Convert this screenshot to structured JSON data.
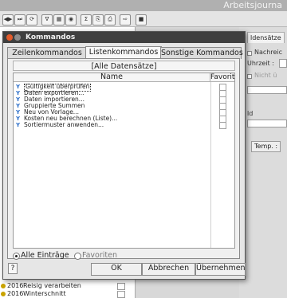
{
  "app": {
    "title": "Arbeitsjourna",
    "toolbar_icons": [
      "first-icon",
      "last-icon",
      "refresh-icon",
      "filter-icon",
      "grid-icon",
      "chart-icon",
      "sum-icon",
      "copy-icon",
      "print-icon",
      "export-icon",
      "stop-icon"
    ],
    "toolbar_glyphs": [
      "◀▶",
      "⏭",
      "⟳",
      "∇",
      "▦",
      "◉",
      "Σ",
      "⎘",
      "⎙",
      "⇨",
      "■"
    ],
    "list_rows": [
      {
        "year": "2016",
        "text": "Reisig verarbeiten"
      },
      {
        "year": "2016",
        "text": "Winterschnitt"
      }
    ],
    "right_panel": {
      "tab": "ldensätze",
      "nachricht": "Nachreic",
      "uhrzeit": "Uhrzeit :",
      "nicht": "Nicht ü",
      "field_suffix": "ld",
      "temp": "Temp. :"
    }
  },
  "dialog": {
    "title": "Kommandos",
    "tabs": [
      {
        "label": "Zeilenkommandos",
        "active": false
      },
      {
        "label": "Listenkommandos",
        "active": true
      },
      {
        "label": "Sonstige Kommandos",
        "active": false
      }
    ],
    "header": "[Alle Datensätze]",
    "columns": {
      "name": "Name",
      "favorit": "Favorit"
    },
    "commands": [
      {
        "label": "Gültigkeit überprüfen",
        "favorit": false,
        "selected": true
      },
      {
        "label": "Daten exportieren...",
        "favorit": false,
        "selected": false
      },
      {
        "label": "Daten importieren...",
        "favorit": false,
        "selected": false
      },
      {
        "label": "Gruppierte Summen",
        "favorit": false,
        "selected": false
      },
      {
        "label": "Neu von Vorlage...",
        "favorit": false,
        "selected": false
      },
      {
        "label": "Kosten neu berechnen (Liste)...",
        "favorit": false,
        "selected": false
      },
      {
        "label": "Sortiermuster anwenden...",
        "favorit": false,
        "selected": false
      }
    ],
    "filter": {
      "all_label": "Alle Einträge",
      "fav_label": "Favoriten",
      "selected": "all"
    },
    "buttons": {
      "help": "?",
      "ok": "OK",
      "cancel": "Abbrechen",
      "apply": "Übernehmen"
    },
    "command_icon_glyph": "Y"
  },
  "colors": {
    "accent_close": "#e35b2b",
    "icon_blue": "#2b6ec9",
    "list_bullet": "#c9a300"
  }
}
